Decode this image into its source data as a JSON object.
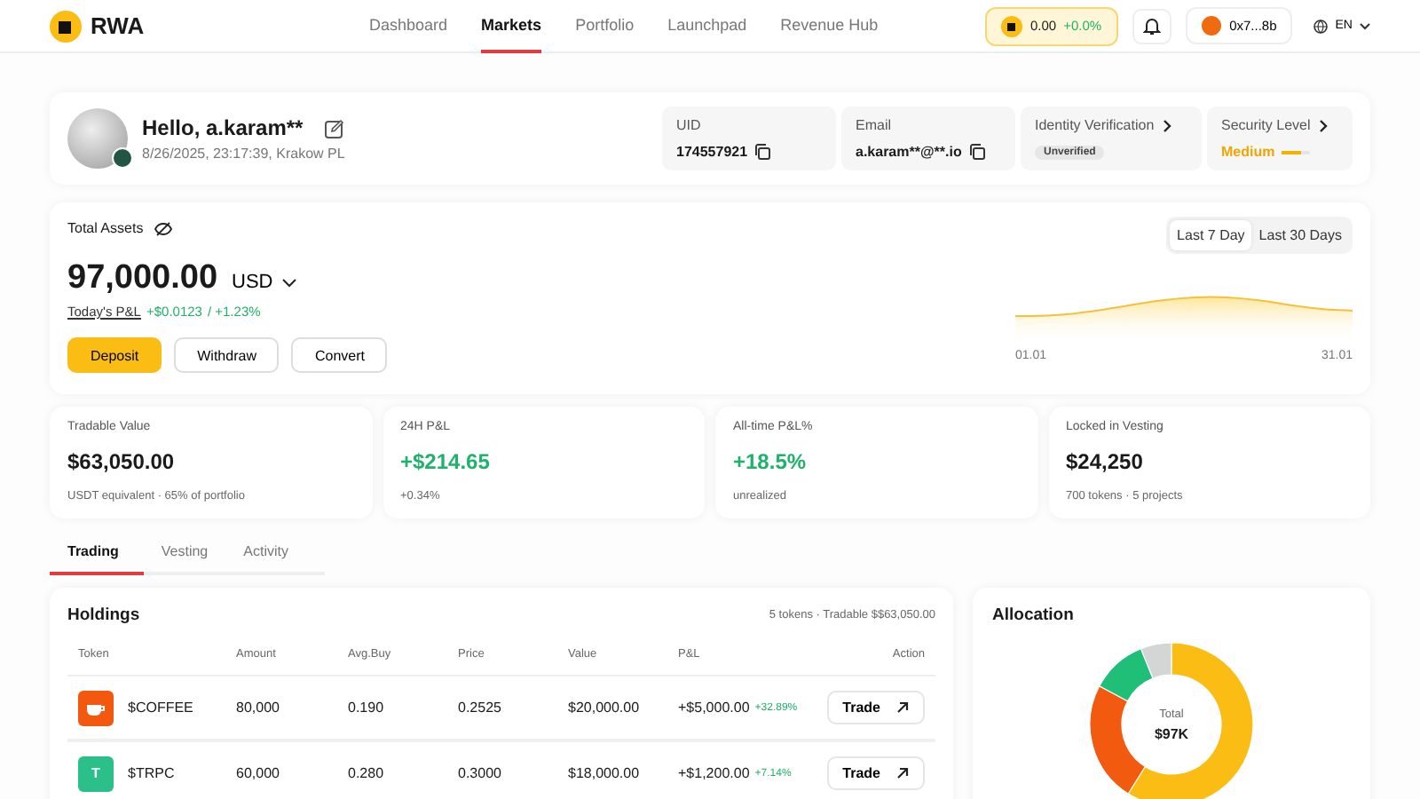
{
  "brand": "RWA",
  "nav": [
    {
      "label": "Dashboard",
      "selected": false
    },
    {
      "label": "Markets",
      "selected": true
    },
    {
      "label": "Portfolio",
      "selected": false
    },
    {
      "label": "Launchpad",
      "selected": false
    },
    {
      "label": "Revenue Hub",
      "selected": false
    }
  ],
  "balance_pill": {
    "amount": "0.00",
    "change": "+0.0%"
  },
  "wallet": "0x7...8b",
  "language": "EN",
  "profile": {
    "greeting": "Hello, a.karam**",
    "meta": "8/26/2025, 23:17:39, Krakow PL",
    "fields": [
      {
        "kind": "copy",
        "label": "UID",
        "value": "174557921"
      },
      {
        "kind": "copy",
        "label": "Email",
        "value": "a.karam**@**.io"
      },
      {
        "kind": "badge",
        "label": "Identity Verification",
        "value": "Unverified"
      },
      {
        "kind": "level",
        "label": "Security Level",
        "value": "Medium",
        "level": 0.66
      }
    ]
  },
  "assets": {
    "label": "Total Assets",
    "amount": "97,000.00",
    "currency": "USD",
    "pnl_label": "Today's P&L",
    "pnl_value": "+$0.0123",
    "pnl_pct": "/ +1.23%",
    "buttons": [
      {
        "label": "Deposit",
        "primary": true
      },
      {
        "label": "Withdraw",
        "primary": false
      },
      {
        "label": "Convert",
        "primary": false
      }
    ],
    "ranges": [
      {
        "label": "Last 7 Day",
        "selected": true
      },
      {
        "label": "Last 30 Days",
        "selected": false
      }
    ],
    "chart_start": "01.01",
    "chart_end": "31.01"
  },
  "stats": [
    {
      "label": "Tradable Value",
      "value": "$63,050.00",
      "positive": false,
      "note": "USDT equivalent · 65% of portfolio"
    },
    {
      "label": "24H P&L",
      "value": "+$214.65",
      "positive": true,
      "note": "+0.34%"
    },
    {
      "label": "All-time P&L%",
      "value": "+18.5%",
      "positive": true,
      "note": "unrealized"
    },
    {
      "label": "Locked in Vesting",
      "value": "$24,250",
      "positive": false,
      "note": "700 tokens · 5 projects"
    }
  ],
  "tabs": [
    {
      "label": "Trading",
      "selected": true
    },
    {
      "label": "Vesting",
      "selected": false
    },
    {
      "label": "Activity",
      "selected": false
    }
  ],
  "holdings": {
    "title": "Holdings",
    "summary": "5 tokens · Tradable $$63,050.00",
    "columns": [
      "Token",
      "Amount",
      "Avg.Buy",
      "Price",
      "Value",
      "P&L",
      "Action"
    ],
    "rows": [
      {
        "kind": "cup",
        "color": "#f2590f",
        "token": "$COFFEE",
        "amount": "80,000",
        "avg_buy": "0.190",
        "price": "0.2525",
        "value": "$20,000.00",
        "pnl": "+$5,000.00",
        "pnl_pct": "+32.89%",
        "action": "Trade"
      },
      {
        "kind": "letter",
        "icon_text": "T",
        "color": "#2bbf8a",
        "token": "$TRPC",
        "amount": "60,000",
        "avg_buy": "0.280",
        "price": "0.3000",
        "value": "$18,000.00",
        "pnl": "+$1,200.00",
        "pnl_pct": "+7.14%",
        "action": "Trade"
      }
    ]
  },
  "allocation": {
    "title": "Allocation",
    "center_label": "Total",
    "center_value": "$97K"
  }
}
